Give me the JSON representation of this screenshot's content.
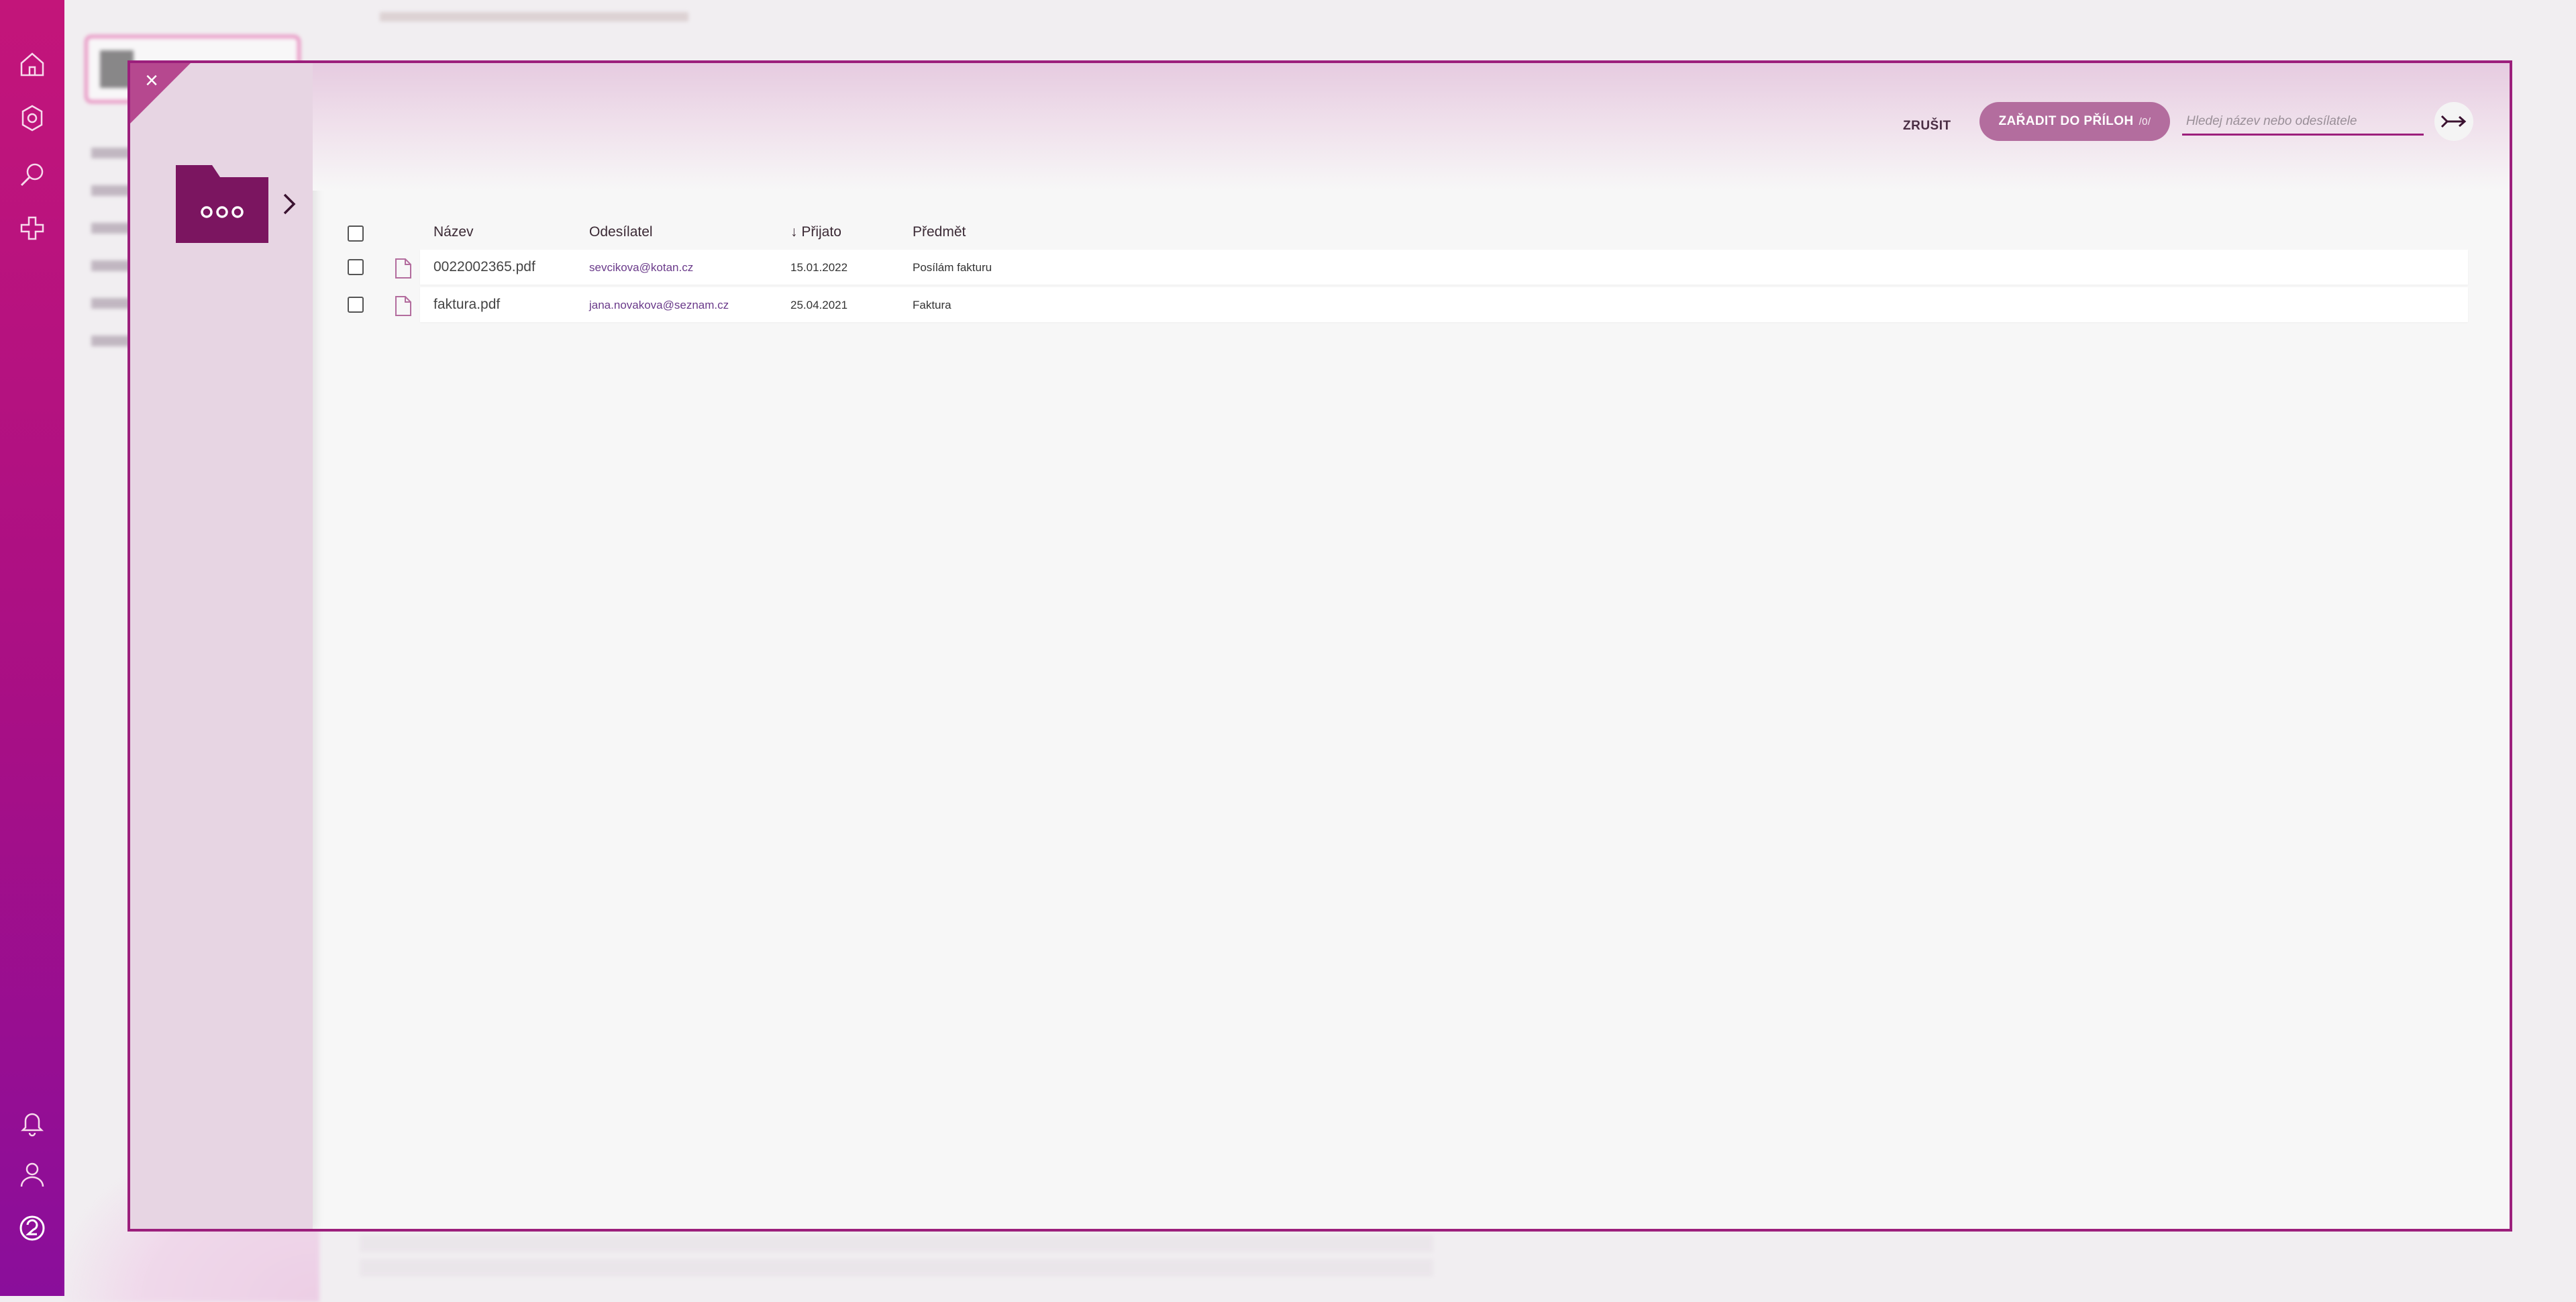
{
  "rail": {
    "top_icons": [
      "home-icon",
      "settings-icon",
      "search-icon",
      "add-icon"
    ],
    "bottom_icons": [
      "bell-icon",
      "user-icon",
      "help-icon"
    ]
  },
  "modal": {
    "close_label": "×",
    "folder_icon": "folder-more-icon",
    "header": {
      "cancel_label": "ZRUŠIT",
      "assign_label": "ZAŘADIT DO PŘÍLOH",
      "assign_count": "/0/",
      "search_placeholder": "Hledej název nebo odesílatele",
      "search_value": ""
    },
    "table": {
      "columns": {
        "name": "Název",
        "sender": "Odesílatel",
        "received": "Přijato",
        "received_sort": "↓",
        "subject": "Předmět"
      },
      "rows": [
        {
          "name": "0022002365.pdf",
          "sender": "sevcikova@kotan.cz",
          "received": "15.01.2022",
          "subject": "Posílám fakturu"
        },
        {
          "name": "faktura.pdf",
          "sender": "jana.novakova@seznam.cz",
          "received": "25.04.2021",
          "subject": "Faktura"
        }
      ]
    }
  },
  "colors": {
    "accent": "#9c1f7c",
    "assign_button": "#b36d9e",
    "sidebar": "#e7d5e3",
    "rail_top": "#c3157a",
    "rail_bottom": "#8a0e9b"
  }
}
